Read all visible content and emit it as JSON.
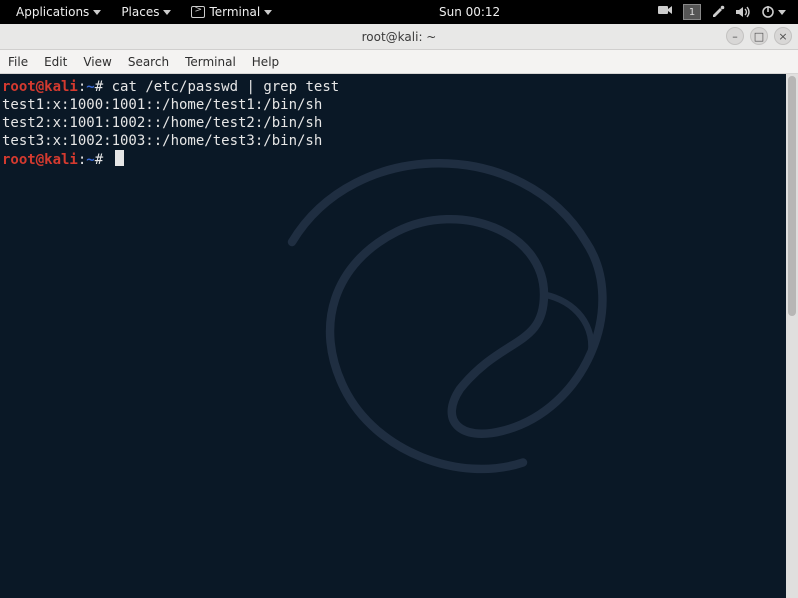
{
  "panel": {
    "applications": "Applications",
    "places": "Places",
    "terminal": "Terminal",
    "clock": "Sun 00:12",
    "workspace": "1"
  },
  "window": {
    "title": "root@kali: ~",
    "min_glyph": "–",
    "max_glyph": "□",
    "close_glyph": "×"
  },
  "menubar": {
    "file": "File",
    "edit": "Edit",
    "view": "View",
    "search": "Search",
    "terminal": "Terminal",
    "help": "Help"
  },
  "prompt": {
    "user_host": "root@kali",
    "path": "~",
    "symbol": "#"
  },
  "terminal": {
    "cmd1": " cat /etc/passwd | grep test",
    "line1": "test1:x:1000:1001::/home/test1:/bin/sh",
    "line2": "test2:x:1001:1002::/home/test2:/bin/sh",
    "line3": "test3:x:1002:1003::/home/test3:/bin/sh"
  }
}
